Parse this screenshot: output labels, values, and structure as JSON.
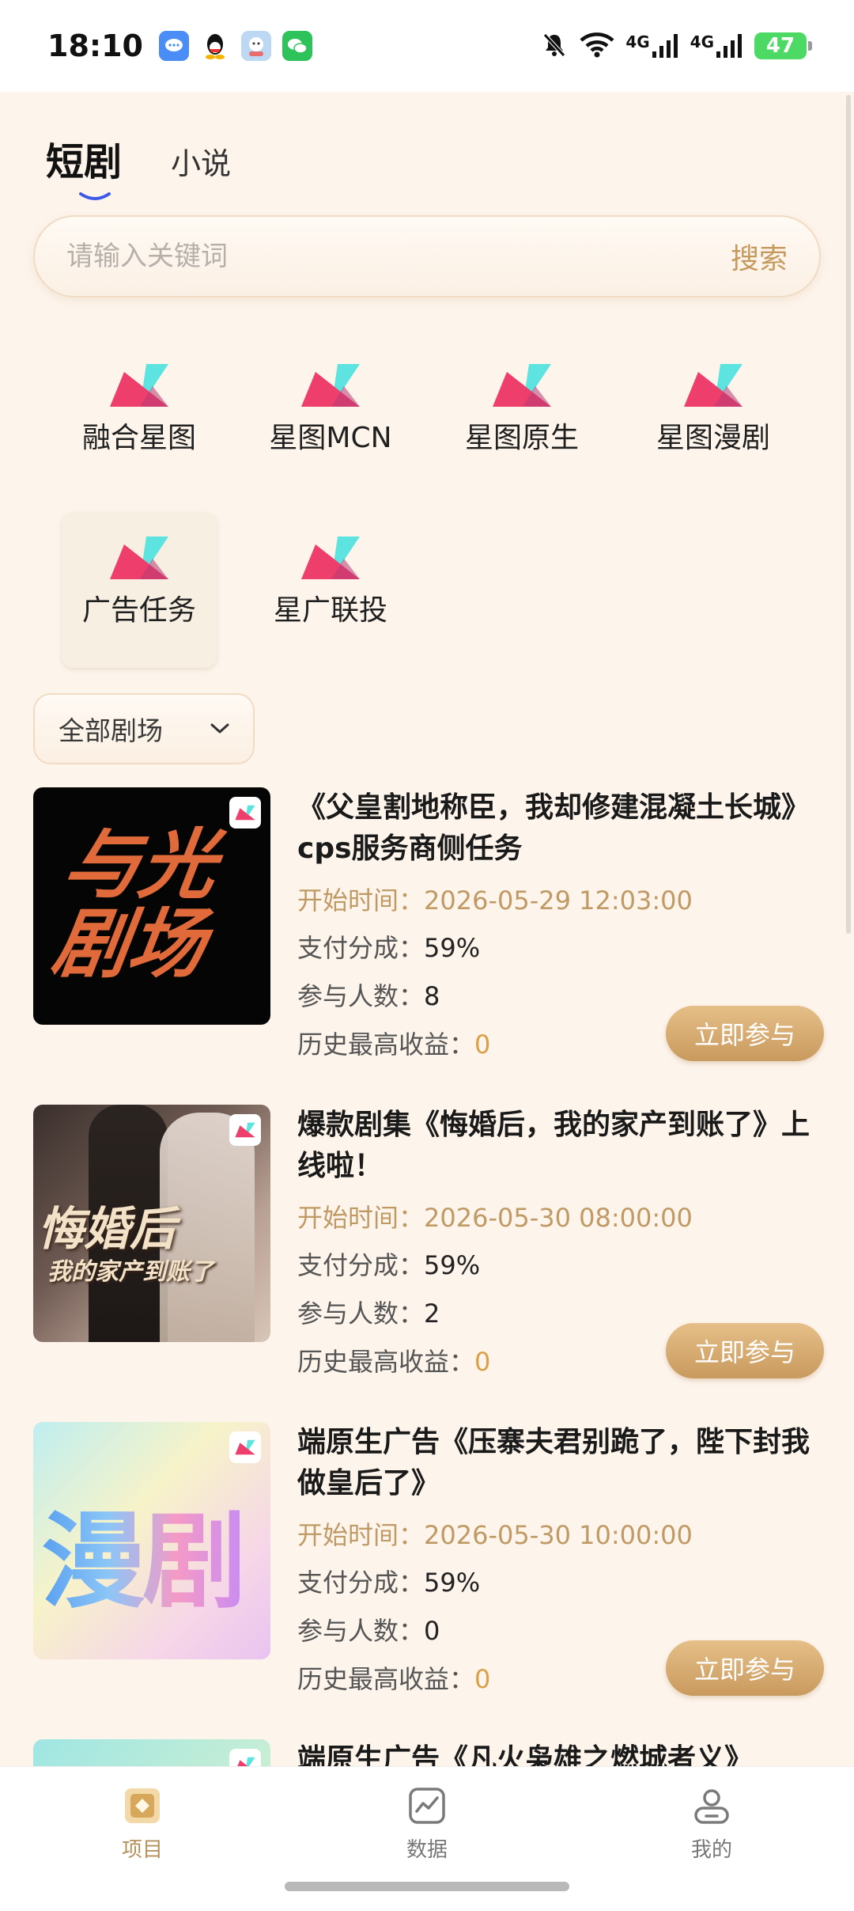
{
  "status_bar": {
    "time": "18:10",
    "network_1": "4G",
    "network_2": "4G",
    "battery": "47",
    "icons": [
      "message-icon",
      "qq-icon",
      "app-icon",
      "wechat-icon",
      "mute-icon",
      "wifi-icon",
      "signal-icon",
      "signal-icon",
      "battery-icon"
    ]
  },
  "tabs": [
    {
      "label": "短剧",
      "active": true
    },
    {
      "label": "小说",
      "active": false
    }
  ],
  "search": {
    "placeholder": "请输入关键词",
    "button": "搜索"
  },
  "categories": [
    {
      "label": "融合星图"
    },
    {
      "label": "星图MCN"
    },
    {
      "label": "星图原生"
    },
    {
      "label": "星图漫剧"
    },
    {
      "label": "广告任务",
      "selected": true
    },
    {
      "label": "星广联投"
    }
  ],
  "filter": {
    "selected": "全部剧场"
  },
  "items": [
    {
      "title": "《父皇割地称臣，我却修建混凝土长城》cps服务商侧任务",
      "thumb_text_1": "与光",
      "thumb_text_2": "剧场",
      "start_label": "开始时间：",
      "start_value": "2026-05-29 12:03:00",
      "share_label": "支付分成：",
      "share_value": "59%",
      "participants_label": "参与人数：",
      "participants_value": "8",
      "earnings_label": "历史最高收益：",
      "earnings_value": "0",
      "button": "立即参与"
    },
    {
      "title": "爆款剧集《悔婚后，我的家产到账了》上线啦！",
      "thumb_text_1": "悔婚后",
      "thumb_text_2": "我的家产到账了",
      "start_label": "开始时间：",
      "start_value": "2026-05-30 08:00:00",
      "share_label": "支付分成：",
      "share_value": "59%",
      "participants_label": "参与人数：",
      "participants_value": "2",
      "earnings_label": "历史最高收益：",
      "earnings_value": "0",
      "button": "立即参与"
    },
    {
      "title": "端原生广告《压寨夫君别跪了，陛下封我做皇后了》",
      "thumb_text_1": "漫剧",
      "start_label": "开始时间：",
      "start_value": "2026-05-30 10:00:00",
      "share_label": "支付分成：",
      "share_value": "59%",
      "participants_label": "参与人数：",
      "participants_value": "0",
      "earnings_label": "历史最高收益：",
      "earnings_value": "0",
      "button": "立即参与"
    },
    {
      "title": "端原生广告《凡火枭雄之燃城者义》"
    }
  ],
  "bottom_nav": [
    {
      "label": "项目",
      "icon": "project-icon",
      "active": true
    },
    {
      "label": "数据",
      "icon": "chart-icon",
      "active": false
    },
    {
      "label": "我的",
      "icon": "profile-icon",
      "active": false
    }
  ],
  "colors": {
    "accent": "#c59a5e",
    "background": "#fdf4ec",
    "logo_pink": "#ee3f6c",
    "logo_cyan": "#5de3e0"
  }
}
